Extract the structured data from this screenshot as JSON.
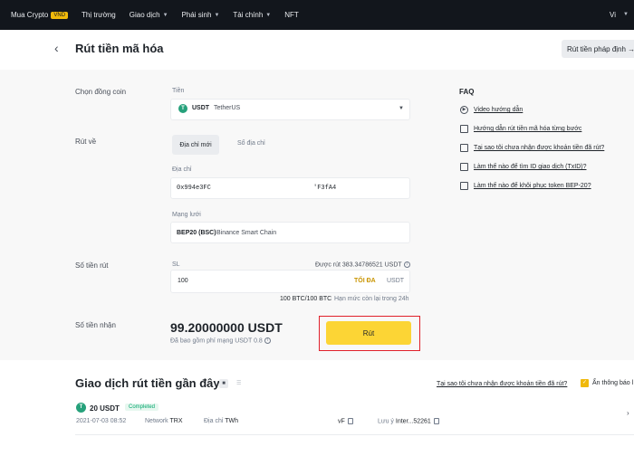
{
  "topnav": {
    "items": [
      {
        "label": "Mua Crypto",
        "badge": "VND",
        "caret": false
      },
      {
        "label": "Thị trường",
        "caret": false
      },
      {
        "label": "Giao dịch",
        "caret": true
      },
      {
        "label": "Phái sinh",
        "caret": true
      },
      {
        "label": "Tài chính",
        "caret": true
      },
      {
        "label": "NFT",
        "caret": false
      }
    ],
    "lang": "Vi"
  },
  "header": {
    "title": "Rút tiền mã hóa",
    "fiat_button": "Rút tiền pháp định →"
  },
  "form": {
    "coin_label": "Chọn đồng coin",
    "coin_sublabel": "Tiền",
    "coin_symbol": "USDT",
    "coin_name": "TetherUS",
    "withdraw_to_label": "Rút về",
    "tab_new_address": "Địa chỉ mới",
    "tab_address_book": "Sổ địa chỉ",
    "address_label": "Địa chỉ",
    "address_start": "0x994e3FC",
    "address_end": "'F3fA4",
    "network_label": "Mạng lưới",
    "network_code": "BEP20 (BSC)",
    "network_name": "Binance Smart Chain",
    "amount_label": "Số tiền rút",
    "amount_sublabel": "SL",
    "available": "Được rút 383.34786521 USDT",
    "amount_value": "100",
    "max_label": "TỐI ĐA",
    "unit": "USDT",
    "limit_value": "100 BTC/100 BTC",
    "limit_text": "Hạn mức còn lại trong 24h",
    "receive_label": "Số tiền nhận",
    "receive_amount": "99.20000000 USDT",
    "fee_text": "Đã bao gồm phí mạng USDT 0.8",
    "submit_label": "Rút"
  },
  "faq": {
    "title": "FAQ",
    "items": [
      {
        "icon": "play-icon",
        "text": "Video hướng dẫn"
      },
      {
        "icon": "document-icon",
        "text": "Hướng dẫn rút tiền mã hóa từng bước"
      },
      {
        "icon": "document-icon",
        "text": "Tại sao tôi chưa nhận được khoản tiền đã rút?"
      },
      {
        "icon": "document-icon",
        "text": "Làm thế nào để tìm ID giao dịch (TxID)?"
      },
      {
        "icon": "document-icon",
        "text": "Làm thế nào để khôi phục token BEP-20?"
      }
    ]
  },
  "recent": {
    "title": "Giao dịch rút tiền gần đây",
    "why_link": "Tại sao tôi chưa nhận được khoản tiền đã rút?",
    "hide_label": "Ẩn thông báo l",
    "row": {
      "amount": "20 USDT",
      "status": "Completed",
      "time": "2021-07-03 08:52",
      "network_label": "Network",
      "network_value": "TRX",
      "address_label": "Địa chỉ",
      "address_value": "TWh",
      "address_tail": "vF",
      "txid_label": "Lưu ý",
      "txid_value": "Inter...52261"
    }
  },
  "colors": {
    "nav_bg": "#12161c",
    "accent": "#fcd535",
    "highlight": "#e0202a",
    "success": "#03a66d",
    "tether": "#26a17b"
  }
}
